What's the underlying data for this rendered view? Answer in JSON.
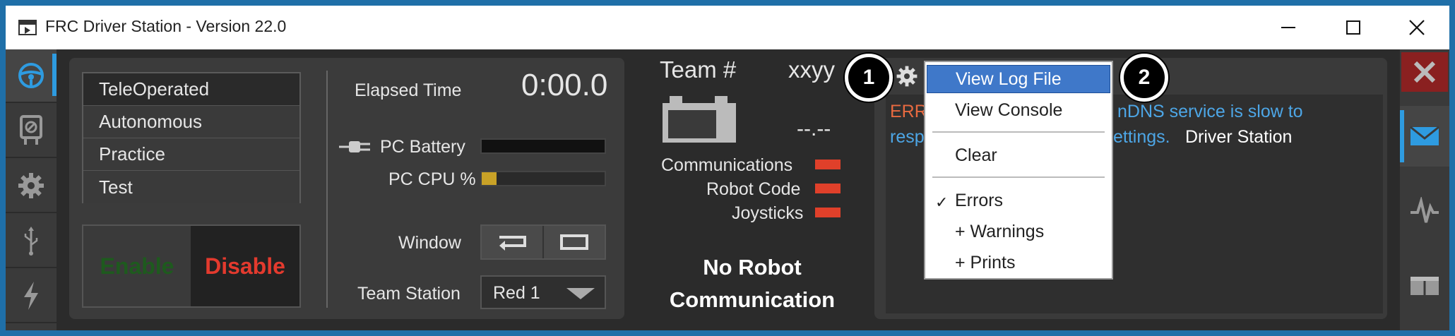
{
  "window": {
    "title": "FRC Driver Station - Version 22.0"
  },
  "left_nav": {
    "items": [
      {
        "icon": "steering-wheel-icon"
      },
      {
        "icon": "diagnostics-icon"
      },
      {
        "icon": "gear-icon"
      },
      {
        "icon": "usb-icon"
      },
      {
        "icon": "power-icon"
      }
    ]
  },
  "modes": {
    "items": [
      "TeleOperated",
      "Autonomous",
      "Practice",
      "Test"
    ],
    "selected": "TeleOperated"
  },
  "controls": {
    "enable_label": "Enable",
    "disable_label": "Disable"
  },
  "stats": {
    "elapsed_label": "Elapsed Time",
    "elapsed_value": "0:00.0",
    "battery_label": "PC Battery",
    "cpu_label": "PC CPU %",
    "cpu_fraction": 0.12,
    "window_label": "Window",
    "team_station_label": "Team Station",
    "team_station_value": "Red 1"
  },
  "status": {
    "team_label": "Team #",
    "team_value": "xxyy",
    "voltage": "--.--",
    "communications_label": "Communications",
    "robot_code_label": "Robot Code",
    "joysticks_label": "Joysticks",
    "indicator_color": "#e0402a",
    "no_robot_line1": "No Robot",
    "no_robot_line2": "Communication"
  },
  "messages": {
    "err_prefix": "ERR",
    "line1_tail": "nDNS service is slow to",
    "line2_head": "resp",
    "line2_mid": "ettings.",
    "line2_source": "Driver Station"
  },
  "menu": {
    "view_log": "View Log File",
    "view_console": "View Console",
    "clear": "Clear",
    "errors": "Errors",
    "warnings": "+ Warnings",
    "prints": "+ Prints",
    "check_mark": "✓"
  },
  "callouts": {
    "one": "1",
    "two": "2"
  },
  "colors": {
    "accent": "#2e9be0",
    "menu_highlight": "#3f78c9",
    "disable_red": "#e33a2e",
    "enable_green": "#1e5a1e"
  }
}
